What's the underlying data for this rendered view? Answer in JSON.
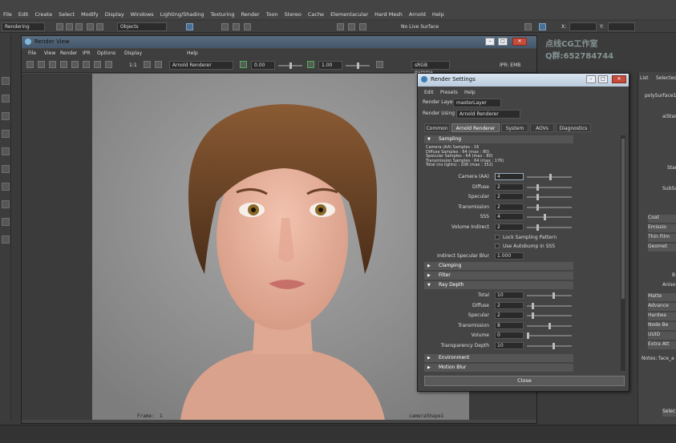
{
  "main_menu": [
    "File",
    "Edit",
    "Create",
    "Select",
    "Modify",
    "Display",
    "Windows",
    "Lighting/Shading",
    "Texturing",
    "Render",
    "Toon",
    "Stereo",
    "Cache",
    "Elementacular",
    "Hard Mesh",
    "Arnold",
    "Help"
  ],
  "shelf": {
    "mode": "Rendering",
    "objects": "Objects",
    "live_surface": "No Live Surface",
    "x_label": "X:",
    "y_label": "Y:"
  },
  "watermark": {
    "line1": "点线CG工作室",
    "line2": "Q群:652784744"
  },
  "right_panel": {
    "list": "List",
    "selected": "Selected",
    "node": "polySurface1",
    "labels": [
      "aiStan",
      "Stan",
      "SubSu",
      "Coat",
      "Emissio",
      "Thin Film",
      "Geomet",
      "B",
      "Aniso",
      "Matte",
      "Advance",
      "Hardwa",
      "Node Be",
      "UUID",
      "Extra Att"
    ],
    "notes": "Notes: face_a",
    "select": "Selec"
  },
  "render_view": {
    "title": "Render View",
    "menu": [
      "File",
      "View",
      "Render",
      "IPR",
      "Options",
      "Display",
      "Help"
    ],
    "ratio": "1:1",
    "renderer": "Arnold Renderer",
    "exposure": "0.00",
    "gamma": "1.00",
    "colorspace": "sRGB gamma",
    "ipr_label": "IPR: EMB",
    "frame_label": "Frame:",
    "frame_value": "1",
    "camera": "cameraShape1"
  },
  "render_settings": {
    "title": "Render Settings",
    "menu": [
      "Edit",
      "Presets",
      "Help"
    ],
    "render_layer_label": "Render Layer",
    "render_layer_value": "masterLayer",
    "render_using_label": "Render Using",
    "render_using_value": "Arnold Renderer",
    "tabs": [
      "Common",
      "Arnold Renderer",
      "System",
      "AOVs",
      "Diagnostics"
    ],
    "sampling_title": "Sampling",
    "info_lines": [
      "Camera (AA) Samples : 16",
      "Diffuse Samples : 64 (max : 80)",
      "Specular Samples : 64 (max : 80)",
      "Transmission Samples : 64 (max : 176)",
      "Total (no lights) : 208 (max : 352)"
    ],
    "sampling_rows": [
      {
        "label": "Camera (AA)",
        "value": "4",
        "level": 0.53
      },
      {
        "label": "Diffuse",
        "value": "2",
        "level": 0.22
      },
      {
        "label": "Specular",
        "value": "2",
        "level": 0.22
      },
      {
        "label": "Transmission",
        "value": "2",
        "level": 0.22
      },
      {
        "label": "SSS",
        "value": "4",
        "level": 0.4
      },
      {
        "label": "Volume Indirect",
        "value": "2",
        "level": 0.22
      }
    ],
    "lock_sampling": "Lock Sampling Pattern",
    "use_autobump": "Use Autobump in SSS",
    "indirect_blur_label": "Indirect Specular Blur",
    "indirect_blur_value": "1.000",
    "clamping": "Clamping",
    "filter": "Filter",
    "ray_depth_title": "Ray Depth",
    "ray_rows": [
      {
        "label": "Total",
        "value": "10",
        "level": 0.6
      },
      {
        "label": "Diffuse",
        "value": "2",
        "level": 0.12
      },
      {
        "label": "Specular",
        "value": "2",
        "level": 0.12
      },
      {
        "label": "Transmission",
        "value": "8",
        "level": 0.5
      },
      {
        "label": "Volume",
        "value": "0",
        "level": 0.0
      },
      {
        "label": "Transparency Depth",
        "value": "10",
        "level": 0.6
      }
    ],
    "environment": "Environment",
    "motion_blur": "Motion Blur",
    "close": "Close"
  }
}
